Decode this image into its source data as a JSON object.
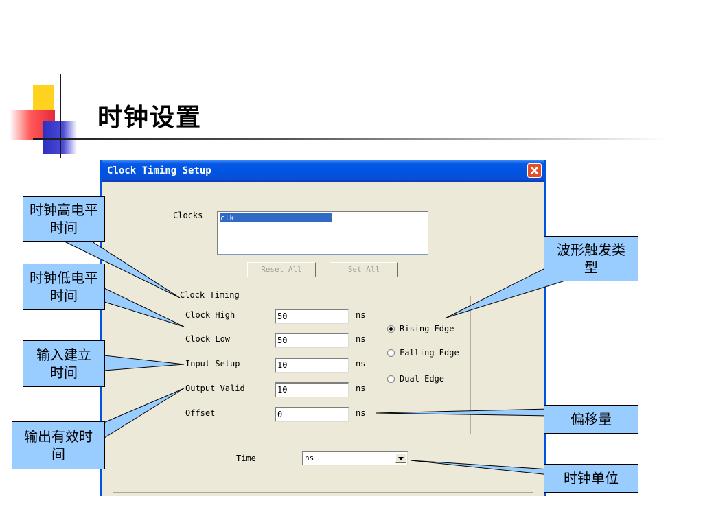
{
  "slide": {
    "title": "时钟设置"
  },
  "dialog": {
    "title": "Clock Timing Setup",
    "clocks_label": "Clocks",
    "clocks": [
      "clk"
    ],
    "reset_all": "Reset All",
    "set_all": "Set All",
    "group_title": "Clock Timing",
    "rows": [
      {
        "label": "Clock High",
        "value": "50",
        "unit": "ns"
      },
      {
        "label": "Clock Low",
        "value": "50",
        "unit": "ns"
      },
      {
        "label": "Input Setup",
        "value": "10",
        "unit": "ns"
      },
      {
        "label": "Output Valid",
        "value": "10",
        "unit": "ns"
      },
      {
        "label": "Offset",
        "value": "0",
        "unit": "ns"
      }
    ],
    "edges": [
      {
        "label": "Rising Edge",
        "selected": true
      },
      {
        "label": "Falling Edge",
        "selected": false
      },
      {
        "label": "Dual Edge",
        "selected": false
      }
    ],
    "time_label": "Time",
    "time_value": "ns"
  },
  "callouts": {
    "clock_high": "时钟高电平时间",
    "clock_low": "时钟低电平时间",
    "input_setup": "输入建立时间",
    "output_valid": "输出有效时间",
    "edge_type": "波形触发类型",
    "offset": "偏移量",
    "clock_unit": "时钟单位"
  },
  "colors": {
    "callout_fill": "#99ccff",
    "titlebar": "#0054e3",
    "dialog_bg": "#ece9d8",
    "selection": "#316ac5"
  }
}
